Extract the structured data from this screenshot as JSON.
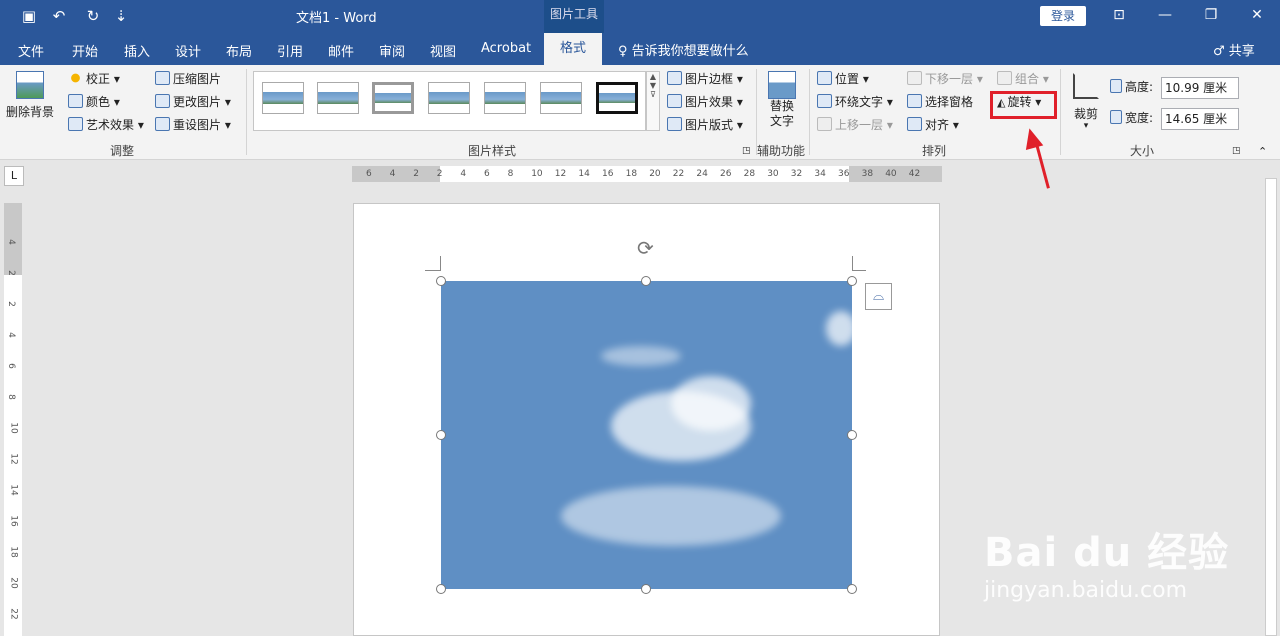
{
  "window": {
    "title": "文档1  -  Word",
    "context_tab": "图片工具",
    "login": "登录"
  },
  "quick_access": [
    "save-icon",
    "undo-icon",
    "redo-icon",
    "customize-icon"
  ],
  "menu": {
    "tabs": [
      "文件",
      "开始",
      "插入",
      "设计",
      "布局",
      "引用",
      "邮件",
      "审阅",
      "视图",
      "Acrobat"
    ],
    "active_tab": "格式",
    "tell_me": "告诉我你想要做什么",
    "share": "共享"
  },
  "ribbon": {
    "remove_bg": "删除背景",
    "adjust": {
      "correct": "校正",
      "color": "颜色",
      "art": "艺术效果",
      "compress": "压缩图片",
      "change": "更改图片",
      "reset": "重设图片",
      "label": "调整"
    },
    "styles": {
      "border": "图片边框",
      "effects": "图片效果",
      "layout": "图片版式",
      "label": "图片样式"
    },
    "accessibility": {
      "alt1": "替换",
      "alt2": "文字",
      "label": "辅助功能"
    },
    "arrange": {
      "position": "位置",
      "wrap": "环绕文字",
      "forward": "上移一层",
      "backward": "下移一层",
      "pane": "选择窗格",
      "align": "对齐",
      "group": "组合",
      "rotate": "旋转",
      "label": "排列"
    },
    "size": {
      "crop": "裁剪",
      "height_label": "高度:",
      "height": "10.99 厘米",
      "width_label": "宽度:",
      "width": "14.65 厘米",
      "label": "大小"
    }
  },
  "ruler": {
    "h_ticks": [
      "6",
      "4",
      "2",
      "2",
      "4",
      "6",
      "8",
      "10",
      "12",
      "14",
      "16",
      "18",
      "20",
      "22",
      "24",
      "26",
      "28",
      "30",
      "32",
      "34",
      "36",
      "38",
      "40",
      "42"
    ],
    "v_ticks": [
      "4",
      "2",
      "2",
      "4",
      "6",
      "8",
      "10",
      "12",
      "14",
      "16",
      "18",
      "20",
      "22"
    ],
    "corner": "L"
  },
  "colors": {
    "accent": "#2b579a",
    "highlight": "#e0202a"
  },
  "watermark": {
    "brand": "Bai du 经验",
    "url": "jingyan.baidu.com"
  }
}
